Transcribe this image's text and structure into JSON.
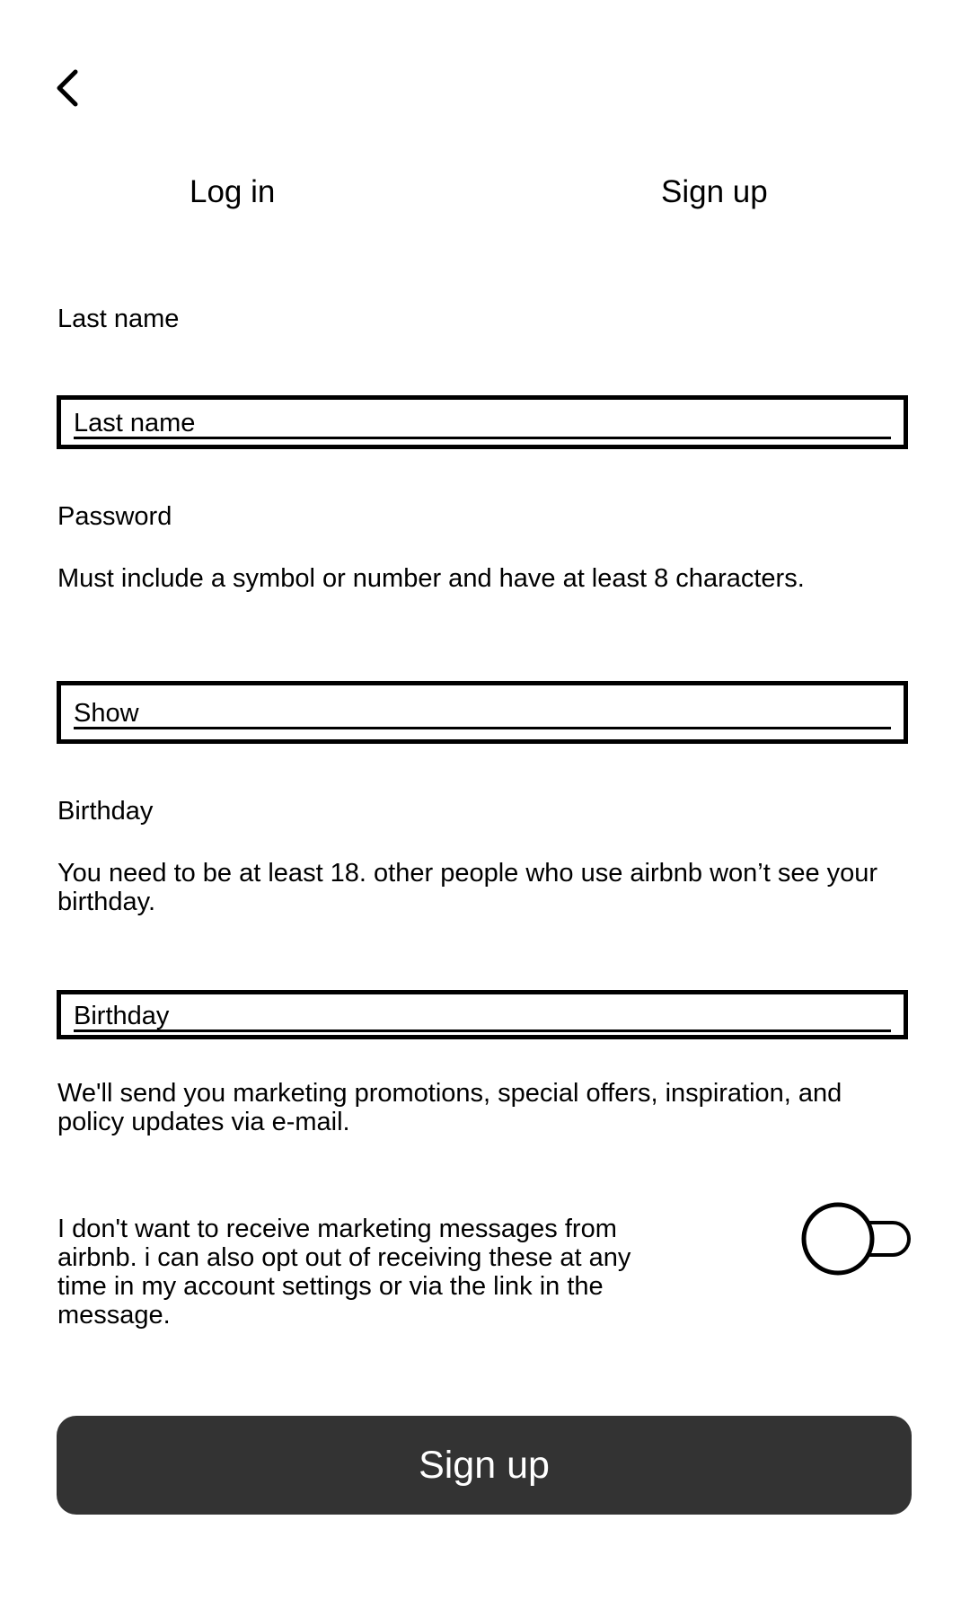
{
  "nav": {
    "back_icon": "chevron-left-icon"
  },
  "tabs": [
    {
      "label": "Log in"
    },
    {
      "label": "Sign up"
    }
  ],
  "form": {
    "last_name": {
      "label": "Last name",
      "placeholder": "Last name"
    },
    "password": {
      "label": "Password",
      "hint": "Must include a symbol or number and have at least 8 characters.",
      "show_label": "Show"
    },
    "birthday": {
      "label": "Birthday",
      "hint": "You need to be at least 18. other people who use airbnb won’t see your birthday.",
      "placeholder": "Birthday"
    },
    "marketing_notice": "We'll send you marketing promotions, special offers, inspiration, and policy updates via e-mail.",
    "opt_out": {
      "text": "I don't want to receive marketing messages from airbnb. i can also opt out of receiving these at any time in my account settings or via the link in the message.",
      "toggle_on": false
    },
    "submit_label": "Sign up"
  },
  "colors": {
    "button_bg": "#333333",
    "button_text": "#ffffff",
    "text": "#000000",
    "background": "#ffffff"
  }
}
